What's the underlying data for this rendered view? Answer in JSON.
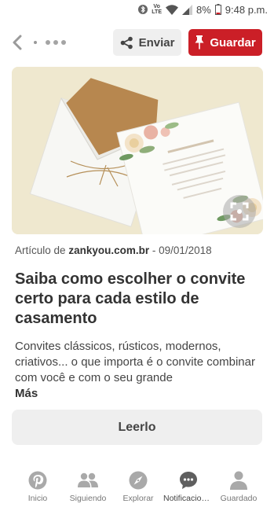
{
  "status_bar": {
    "volte_line1": "Vo",
    "volte_line2": "LTE",
    "battery": "8%",
    "time": "9:48 p.m."
  },
  "toolbar": {
    "send_label": "Enviar",
    "save_label": "Guardar"
  },
  "colors": {
    "save_button": "#cb1f27",
    "secondary_button": "#efefef"
  },
  "article": {
    "meta_prefix": "Artículo de",
    "domain": "zankyou.com.br",
    "date": "- 09/01/2018",
    "title": "Saiba como escolher o convite certo para cada estilo de casamento",
    "description": "Convites clássicos, rústicos, modernos, criativos... o que importa é o convite combinar com você e com o seu grande",
    "more_label": "Más",
    "read_button": "Leerlo"
  },
  "bottom_nav": {
    "items": [
      {
        "label": "Inicio",
        "icon": "pinterest-icon"
      },
      {
        "label": "Siguiendo",
        "icon": "people-icon"
      },
      {
        "label": "Explorar",
        "icon": "compass-icon"
      },
      {
        "label": "Notificaciones",
        "icon": "chat-bubble-icon"
      },
      {
        "label": "Guardado",
        "icon": "person-icon"
      }
    ]
  }
}
